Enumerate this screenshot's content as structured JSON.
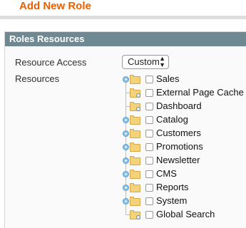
{
  "page": {
    "title": "Add New Role"
  },
  "section": {
    "header": "Roles Resources",
    "resource_access_label": "Resource Access",
    "resource_access_value": "Custom",
    "resources_label": "Resources"
  },
  "tree": [
    {
      "label": "Sales",
      "icon": "folder-icon",
      "expandable": true,
      "checked": false
    },
    {
      "label": "External Page Cache",
      "icon": "folder-search-icon",
      "expandable": false,
      "checked": false
    },
    {
      "label": "Dashboard",
      "icon": "folder-search-icon",
      "expandable": false,
      "checked": false
    },
    {
      "label": "Catalog",
      "icon": "folder-icon",
      "expandable": true,
      "checked": false
    },
    {
      "label": "Customers",
      "icon": "folder-icon",
      "expandable": true,
      "checked": false
    },
    {
      "label": "Promotions",
      "icon": "folder-icon",
      "expandable": true,
      "checked": false
    },
    {
      "label": "Newsletter",
      "icon": "folder-icon",
      "expandable": true,
      "checked": false
    },
    {
      "label": "CMS",
      "icon": "folder-icon",
      "expandable": true,
      "checked": false
    },
    {
      "label": "Reports",
      "icon": "folder-icon",
      "expandable": true,
      "checked": false
    },
    {
      "label": "System",
      "icon": "folder-icon",
      "expandable": true,
      "checked": false
    },
    {
      "label": "Global Search",
      "icon": "folder-search-icon",
      "expandable": false,
      "checked": false
    }
  ]
}
